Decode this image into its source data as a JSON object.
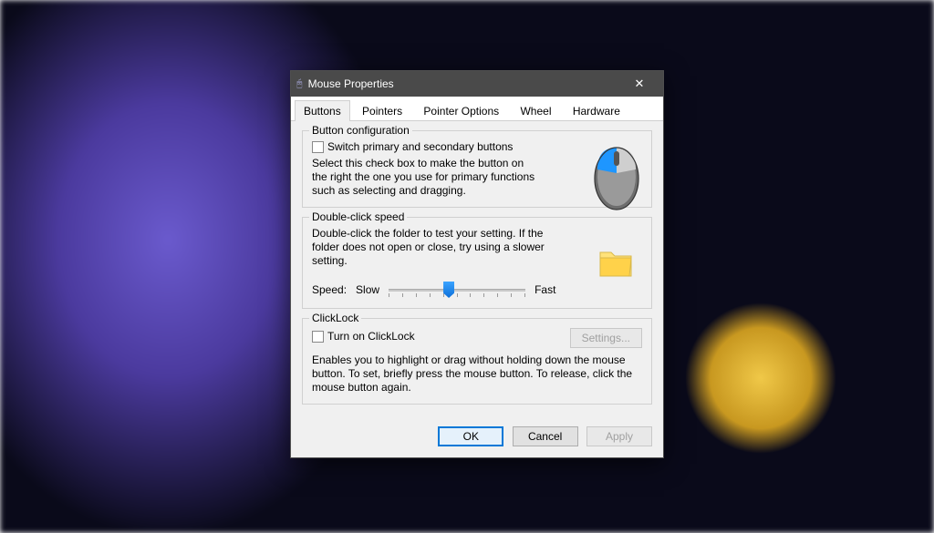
{
  "titlebar": {
    "title": "Mouse Properties"
  },
  "tabs": [
    "Buttons",
    "Pointers",
    "Pointer Options",
    "Wheel",
    "Hardware"
  ],
  "active_tab": 0,
  "button_config": {
    "title": "Button configuration",
    "checkbox_label": "Switch primary and secondary buttons",
    "checked": false,
    "desc": "Select this check box to make the button on the right the one you use for primary functions such as selecting and dragging."
  },
  "double_click": {
    "title": "Double-click speed",
    "desc": "Double-click the folder to test your setting. If the folder does not open or close, try using a slower setting.",
    "speed_label": "Speed:",
    "slow_label": "Slow",
    "fast_label": "Fast",
    "slider_value": 5,
    "slider_min": 0,
    "slider_max": 10
  },
  "clicklock": {
    "title": "ClickLock",
    "checkbox_label": "Turn on ClickLock",
    "checked": false,
    "settings_btn": "Settings...",
    "settings_enabled": false,
    "desc": "Enables you to highlight or drag without holding down the mouse button. To set, briefly press the mouse button. To release, click the mouse button again."
  },
  "footer": {
    "ok": "OK",
    "cancel": "Cancel",
    "apply": "Apply",
    "apply_enabled": false
  }
}
